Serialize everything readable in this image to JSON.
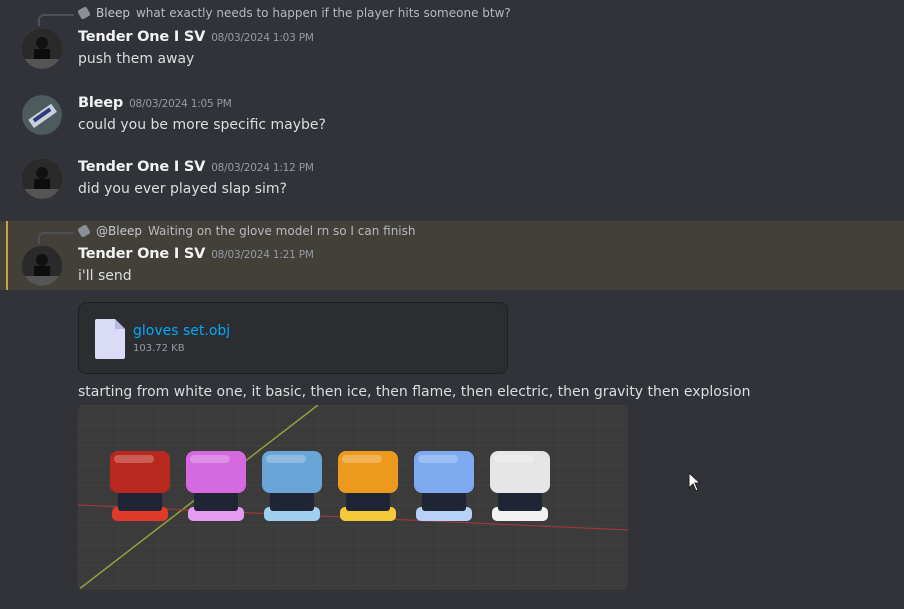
{
  "messages": [
    {
      "reply": {
        "author": "Bleep",
        "text": "what exactly needs to happen if the player hits someone btw?"
      },
      "author": "Tender One I SV",
      "timestamp": "08/03/2024 1:03 PM",
      "text": "push them away"
    },
    {
      "author": "Bleep",
      "timestamp": "08/03/2024 1:05 PM",
      "text": "could you be more specific maybe?"
    },
    {
      "author": "Tender One I SV",
      "timestamp": "08/03/2024 1:12 PM",
      "text": "did you ever played slap sim?"
    },
    {
      "reply": {
        "author": "@Bleep",
        "text": "Waiting on the glove model rn so I can finish"
      },
      "author": "Tender One I SV",
      "timestamp": "08/03/2024 1:21 PM",
      "text": "i'll send",
      "highlighted": true
    }
  ],
  "attachment": {
    "file_name": "gloves set.obj",
    "file_size": "103.72 KB"
  },
  "followup_text": "starting from white one, it basic, then ice, then flame, then electric, then gravity then explosion",
  "preview": {
    "gloves": [
      {
        "color": "#b8281f",
        "cuff": "#e23a2a"
      },
      {
        "color": "#d469e0",
        "cuff": "#e49bf0"
      },
      {
        "color": "#6aa5d8",
        "cuff": "#9fd0f0"
      },
      {
        "color": "#ec9a1e",
        "cuff": "#f4c93a"
      },
      {
        "color": "#7eaaf0",
        "cuff": "#b7d1f8"
      },
      {
        "color": "#e6e6e6",
        "cuff": "#f2f2f2"
      }
    ]
  },
  "colors": {
    "background": "#313338",
    "link": "#00a8fc",
    "highlight": "#433f39",
    "highlight_bar": "#c9a43a"
  }
}
